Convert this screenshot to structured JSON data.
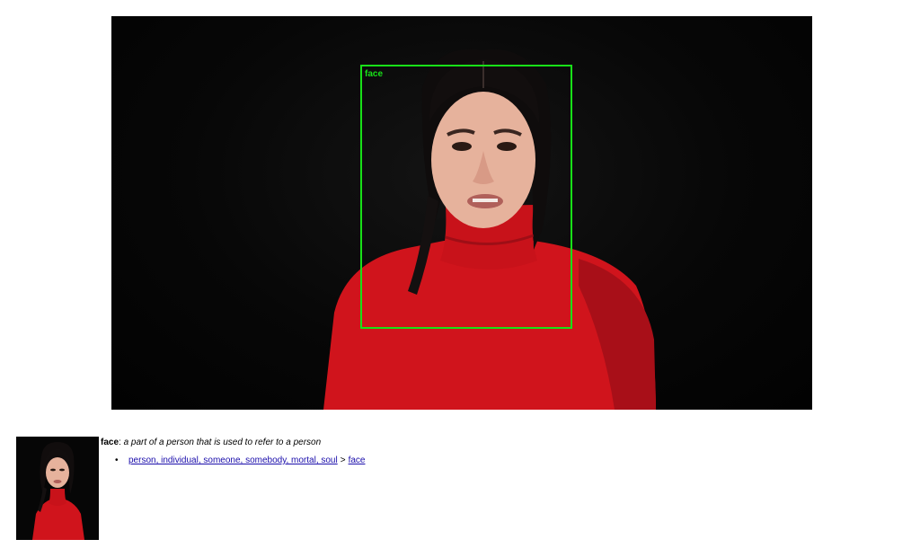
{
  "detection": {
    "label": "face",
    "box_color": "#18e018"
  },
  "caption": {
    "term": "face",
    "colon": ":",
    "definition": "a part of a person that is used to refer to a person"
  },
  "hierarchy": {
    "parent_link": "person, individual, someone, somebody, mortal, soul",
    "separator": ">",
    "child_link": "face"
  },
  "colors": {
    "background": "#050505",
    "sweater": "#d0141c",
    "link": "#1a0dab"
  }
}
